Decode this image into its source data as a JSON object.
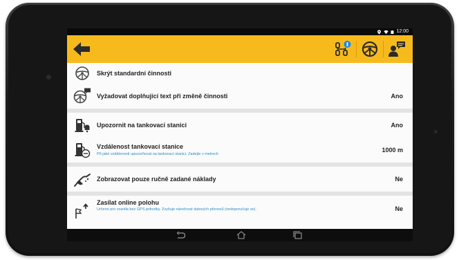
{
  "status_bar": {
    "time": "12:00"
  },
  "app_bar": {
    "back_icon": "arrow-left-icon",
    "actions": [
      "activities-tree-icon",
      "steering-wheel-icon",
      "driver-message-icon"
    ],
    "badge_color": "#1e88e5"
  },
  "settings": [
    {
      "icon": "steering-wheel-hide-icon",
      "title": "Skrýt standardní činnosti",
      "subtitle": "",
      "value": ""
    },
    {
      "icon": "steering-wheel-message-icon",
      "title": "Vyžadovat doplňující text při změně činnosti",
      "subtitle": "",
      "value": "Ano"
    },
    {
      "icon": "fuel-alert-icon",
      "title": "Upozornit na tankovací stanici",
      "subtitle": "",
      "value": "Ano"
    },
    {
      "icon": "fuel-distance-icon",
      "title": "Vzdálenost tankovací stanice",
      "subtitle": "Při jaké vzdálenosti upozorňovat na tankovací stanici. Zadejte v metrech",
      "value": "1000 m"
    },
    {
      "icon": "manual-costs-icon",
      "title": "Zobrazovat pouze ručně zadané náklady",
      "subtitle": "",
      "value": "Ne"
    },
    {
      "icon": "flag-upload-icon",
      "title": "Zasílat online polohu",
      "subtitle": "Určeno pro vozidla bez GPS jednotky. Zvyšuje náročnost datových přenosů (nedoporučuje se).",
      "value": "Ne"
    }
  ],
  "nav_bar": {
    "icons": [
      "back-nav-icon",
      "home-nav-icon",
      "recent-apps-icon"
    ]
  },
  "colors": {
    "app_bar": "#f7ba1d",
    "subtitle": "#2a8bc7",
    "divider": "#e3e3e3"
  }
}
